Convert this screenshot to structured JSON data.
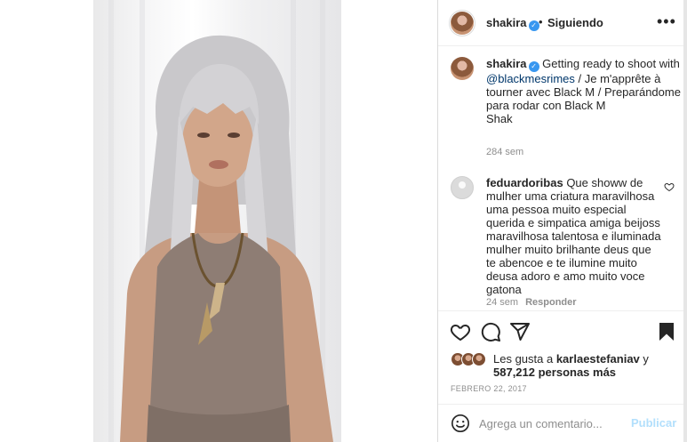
{
  "post": {
    "author": "shakira",
    "follow_status": "Siguiendo",
    "more_label": "•••",
    "verified_mark": "✓"
  },
  "caption": {
    "text_before": "Getting ready to shoot with ",
    "mention": "@blackmesrimes",
    "text_after": " / Je m'apprête à tourner avec Black M / Preparándome para rodar con Black M",
    "signoff": "Shak",
    "time": "284 sem"
  },
  "comment": {
    "author": "feduardoribas",
    "text": "Que showw de mulher uma criatura maravilhosa uma pessoa muito especial querida e simpatica amiga beijoss maravilhosa talentosa e iluminada mulher muito brilhante deus que te abencoe e te ilumine muito deusa adoro e amo muito voce gatona",
    "time": "24 sem",
    "reply_label": "Responder"
  },
  "likes": {
    "prefix": "Les gusta a ",
    "first_user": "karlaestefaniav",
    "joiner": " y",
    "others": "587,212 personas más"
  },
  "date": "FEBRERO 22, 2017",
  "add_comment": {
    "placeholder": "Agrega un comentario...",
    "publish_label": "Publicar"
  },
  "icons": [
    "more-options-icon",
    "verified-badge-icon",
    "heart-icon",
    "comment-icon",
    "share-icon",
    "bookmark-icon",
    "emoji-icon"
  ],
  "colors": {
    "link": "#00376b",
    "verified": "#3897f0",
    "publish_disabled": "#b2dffc",
    "muted": "#8e8e8e"
  }
}
